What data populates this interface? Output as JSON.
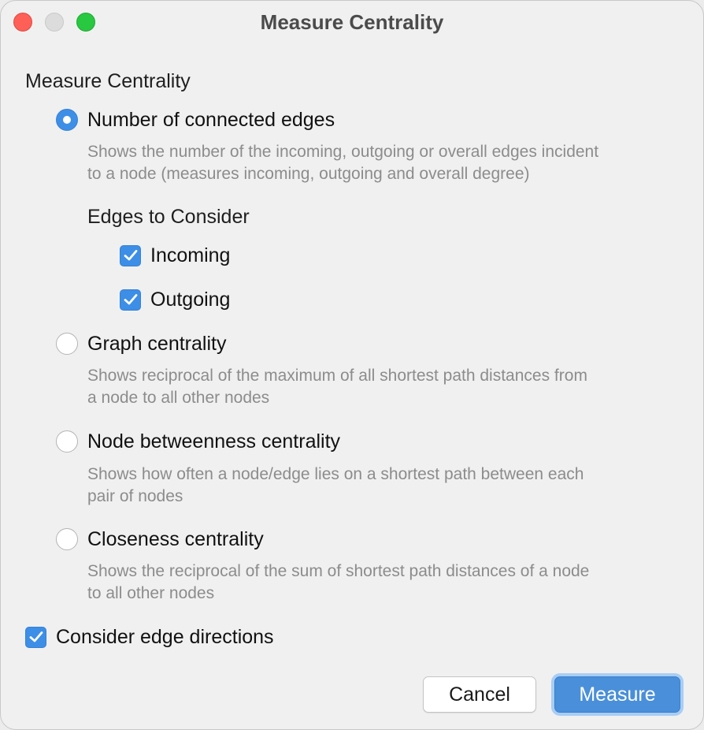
{
  "window": {
    "title": "Measure Centrality"
  },
  "main": {
    "section_label": "Measure Centrality",
    "options": [
      {
        "label": "Number of connected edges",
        "selected": true,
        "description_lines": [
          "Shows the number of the incoming, outgoing or overall edges incident",
          "to a node (measures incoming, outgoing and overall degree)"
        ]
      },
      {
        "label": "Graph centrality",
        "selected": false,
        "description_lines": [
          "Shows reciprocal of the maximum of all shortest path distances from",
          "a node to all other nodes"
        ]
      },
      {
        "label": "Node betweenness centrality",
        "selected": false,
        "description_lines": [
          "Shows how often a node/edge lies on a shortest path between each",
          "pair of nodes"
        ]
      },
      {
        "label": "Closeness centrality",
        "selected": false,
        "description_lines": [
          "Shows the reciprocal of the sum of shortest path distances of a node",
          "to all other nodes"
        ]
      }
    ],
    "edges_to_consider": {
      "label": "Edges to Consider",
      "incoming": {
        "label": "Incoming",
        "checked": true
      },
      "outgoing": {
        "label": "Outgoing",
        "checked": true
      }
    },
    "consider_edge_directions": {
      "label": "Consider edge directions",
      "checked": true
    }
  },
  "buttons": {
    "cancel_label": "Cancel",
    "measure_label": "Measure"
  },
  "colors": {
    "accent": "#3d8ee6",
    "close": "#fe5f57",
    "minimize": "#dcdcdc",
    "zoom": "#28c840"
  }
}
